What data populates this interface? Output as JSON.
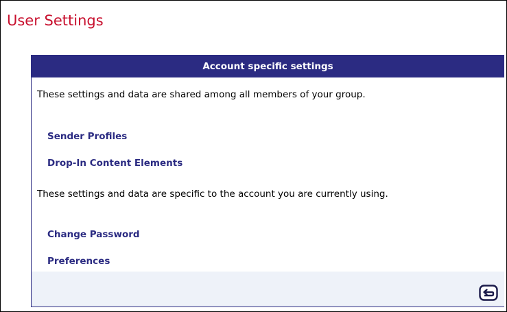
{
  "page": {
    "title": "User Settings"
  },
  "panel": {
    "header": "Account specific settings",
    "group_description": "These settings and data are shared among all members of your group.",
    "group_links": [
      {
        "label": "Sender Profiles"
      },
      {
        "label": "Drop-In Content Elements"
      }
    ],
    "account_description": "These settings and data are specific to the account you are currently using.",
    "account_links": [
      {
        "label": "Change Password"
      },
      {
        "label": "Preferences"
      }
    ],
    "footer": {
      "back_icon": "return-arrow-icon"
    }
  },
  "colors": {
    "title": "#c8102e",
    "accent": "#2b2b82",
    "footer_bg": "#eef2f9"
  }
}
